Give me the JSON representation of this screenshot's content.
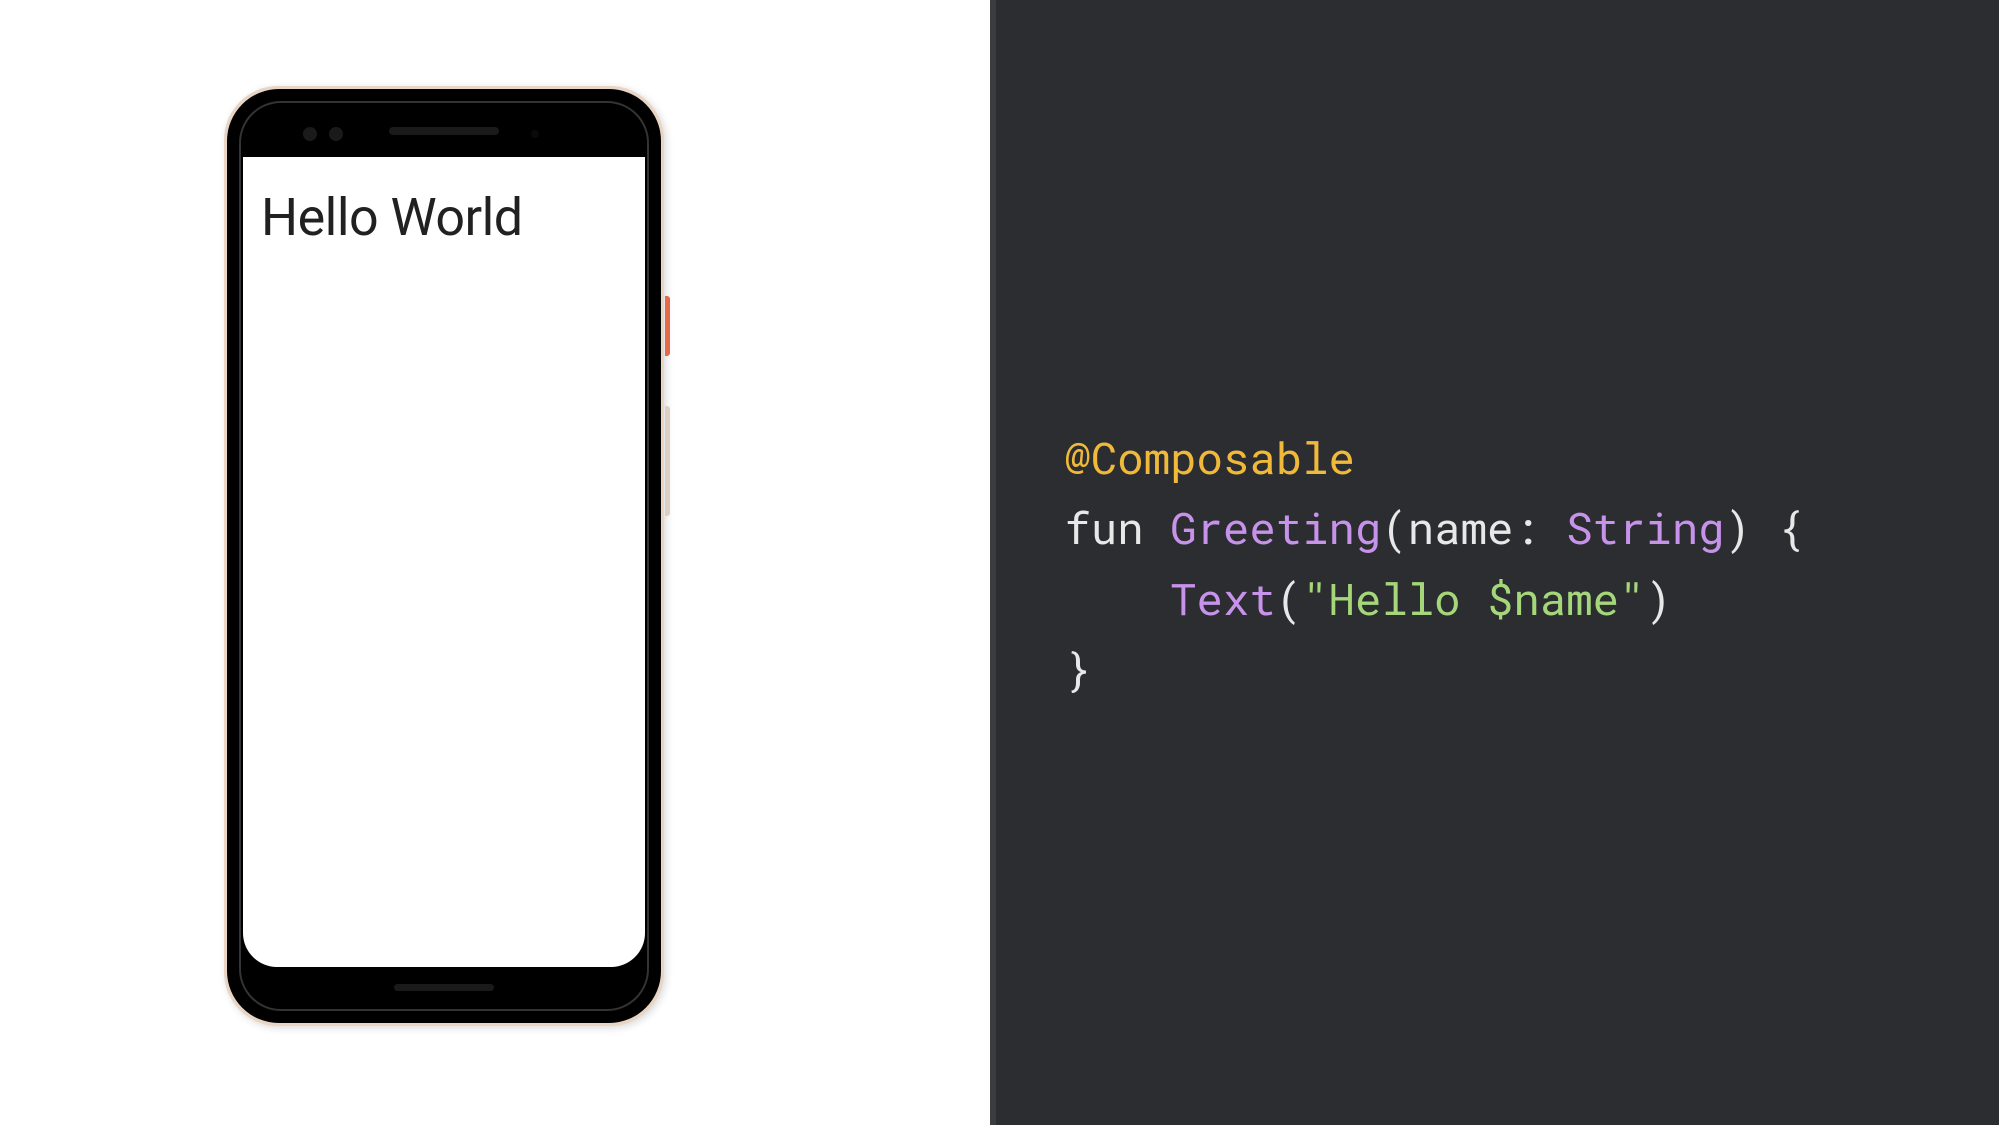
{
  "phone": {
    "screen_text": "Hello World"
  },
  "code": {
    "annotation": "@Composable",
    "keyword_fun": "fun",
    "func_name": "Greeting",
    "paren_open": "(",
    "param_name": "name",
    "colon_space": ": ",
    "param_type": "String",
    "paren_close": ")",
    "brace_open": " {",
    "indent": "    ",
    "text_call": "Text",
    "call_open": "(",
    "string_literal": "\"Hello $name\"",
    "call_close": ")",
    "brace_close": "}"
  }
}
